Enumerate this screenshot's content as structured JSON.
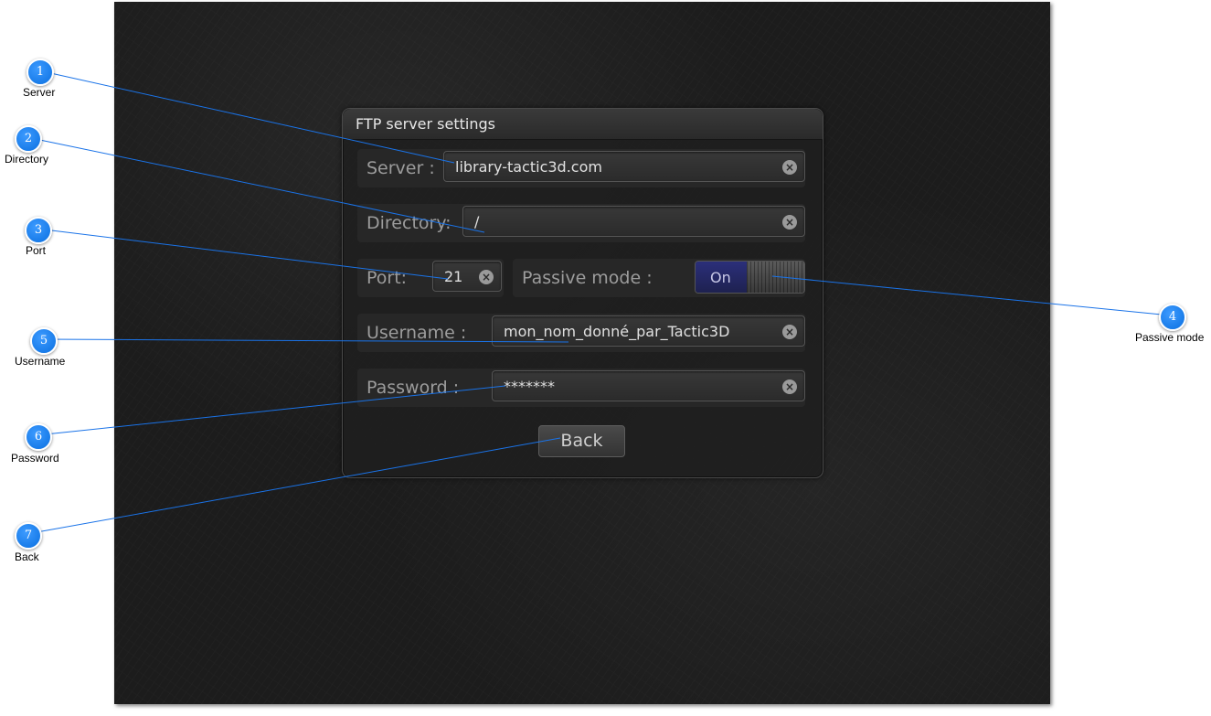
{
  "dialog": {
    "title": "FTP server settings",
    "server": {
      "label": "Server :",
      "value": "library-tactic3d.com"
    },
    "directory": {
      "label": "Directory:",
      "value": "/"
    },
    "port": {
      "label": "Port:",
      "value": "21"
    },
    "passive_mode": {
      "label": "Passive mode :",
      "state_label": "On"
    },
    "username": {
      "label": "Username :",
      "value": "mon_nom_donné_par_Tactic3D"
    },
    "password": {
      "label": "Password :",
      "value": "*******"
    },
    "back_label": "Back",
    "clear_icon": "clear-icon"
  },
  "callouts": [
    {
      "number": "1",
      "label": "Server"
    },
    {
      "number": "2",
      "label": "Directory"
    },
    {
      "number": "3",
      "label": "Port"
    },
    {
      "number": "4",
      "label": "Passive mode"
    },
    {
      "number": "5",
      "label": "Username"
    },
    {
      "number": "6",
      "label": "Password"
    },
    {
      "number": "7",
      "label": "Back"
    }
  ],
  "colors": {
    "callout_badge": "#0a6fe0",
    "callout_line": "#1a73e8",
    "toggle_on": "#2b2f7a",
    "background": "#1c1c1c"
  }
}
